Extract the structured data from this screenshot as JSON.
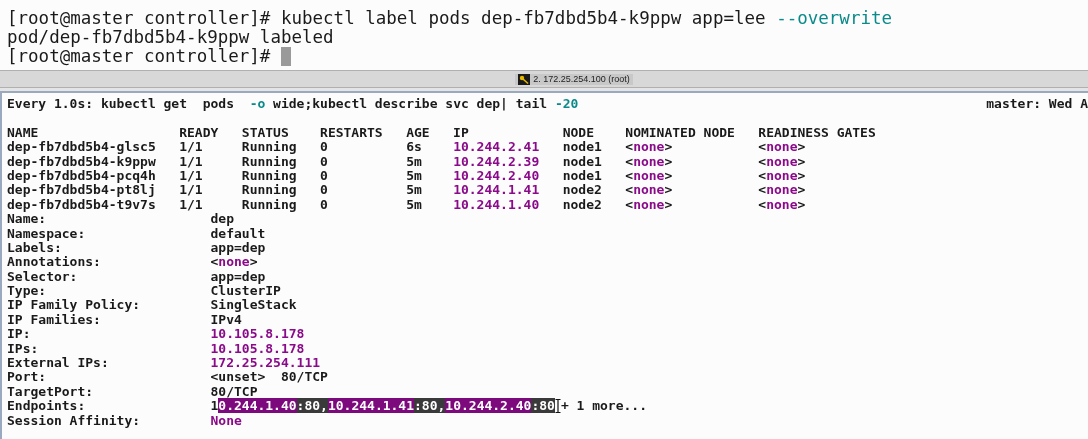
{
  "top_pane": {
    "lines": [
      {
        "segments": [
          {
            "kind": "plain",
            "text": "[root@master controller]# kubectl label pods dep-fb7dbd5b4-k9ppw app=lee "
          },
          {
            "kind": "option",
            "text": "--overwrite"
          }
        ]
      },
      {
        "segments": [
          {
            "kind": "plain",
            "text": "pod/dep-fb7dbd5b4-k9ppw labeled"
          }
        ]
      },
      {
        "segments": [
          {
            "kind": "plain",
            "text": "[root@master controller]# "
          },
          {
            "kind": "cursor"
          }
        ]
      }
    ]
  },
  "tab_bar": {
    "label": "2. 172.25.254.100 (root)"
  },
  "bottom_pane": {
    "header": {
      "segments": [
        {
          "kind": "plain",
          "text": "Every 1.0s: kubectl get  pods  "
        },
        {
          "kind": "option",
          "text": "-o"
        },
        {
          "kind": "plain",
          "text": " wide;kubectl describe svc dep| tail "
        },
        {
          "kind": "option",
          "text": "-20"
        }
      ],
      "right": "master: Wed A"
    },
    "lines": [
      {
        "segments": [
          {
            "kind": "plain",
            "text": "NAME                  READY   STATUS    RESTARTS   AGE   IP            NODE    NOMINATED NODE   READINESS GATES"
          }
        ]
      },
      {
        "segments": [
          {
            "kind": "plain",
            "text": "dep-fb7dbd5b4-glsc5   1/1     Running   0          6s    "
          },
          {
            "kind": "value",
            "text": "10.244.2.41"
          },
          {
            "kind": "plain",
            "text": "   node1   <"
          },
          {
            "kind": "value",
            "text": "none"
          },
          {
            "kind": "plain",
            "text": ">           <"
          },
          {
            "kind": "value",
            "text": "none"
          },
          {
            "kind": "plain",
            "text": ">"
          }
        ]
      },
      {
        "segments": [
          {
            "kind": "plain",
            "text": "dep-fb7dbd5b4-k9ppw   1/1     Running   0          5m    "
          },
          {
            "kind": "value",
            "text": "10.244.2.39"
          },
          {
            "kind": "plain",
            "text": "   node1   <"
          },
          {
            "kind": "value",
            "text": "none"
          },
          {
            "kind": "plain",
            "text": ">           <"
          },
          {
            "kind": "value",
            "text": "none"
          },
          {
            "kind": "plain",
            "text": ">"
          }
        ]
      },
      {
        "segments": [
          {
            "kind": "plain",
            "text": "dep-fb7dbd5b4-pcq4h   1/1     Running   0          5m    "
          },
          {
            "kind": "value",
            "text": "10.244.2.40"
          },
          {
            "kind": "plain",
            "text": "   node1   <"
          },
          {
            "kind": "value",
            "text": "none"
          },
          {
            "kind": "plain",
            "text": ">           <"
          },
          {
            "kind": "value",
            "text": "none"
          },
          {
            "kind": "plain",
            "text": ">"
          }
        ]
      },
      {
        "segments": [
          {
            "kind": "plain",
            "text": "dep-fb7dbd5b4-pt8lj   1/1     Running   0          5m    "
          },
          {
            "kind": "value",
            "text": "10.244.1.41"
          },
          {
            "kind": "plain",
            "text": "   node2   <"
          },
          {
            "kind": "value",
            "text": "none"
          },
          {
            "kind": "plain",
            "text": ">           <"
          },
          {
            "kind": "value",
            "text": "none"
          },
          {
            "kind": "plain",
            "text": ">"
          }
        ]
      },
      {
        "segments": [
          {
            "kind": "plain",
            "text": "dep-fb7dbd5b4-t9v7s   1/1     Running   0          5m    "
          },
          {
            "kind": "value",
            "text": "10.244.1.40"
          },
          {
            "kind": "plain",
            "text": "   node2   <"
          },
          {
            "kind": "value",
            "text": "none"
          },
          {
            "kind": "plain",
            "text": ">           <"
          },
          {
            "kind": "value",
            "text": "none"
          },
          {
            "kind": "plain",
            "text": ">"
          }
        ]
      },
      {
        "segments": [
          {
            "kind": "plain",
            "text": "Name:                     dep"
          }
        ]
      },
      {
        "segments": [
          {
            "kind": "plain",
            "text": "Namespace:                default"
          }
        ]
      },
      {
        "segments": [
          {
            "kind": "plain",
            "text": "Labels:                   app=dep"
          }
        ]
      },
      {
        "segments": [
          {
            "kind": "plain",
            "text": "Annotations:              <"
          },
          {
            "kind": "value",
            "text": "none"
          },
          {
            "kind": "plain",
            "text": ">"
          }
        ]
      },
      {
        "segments": [
          {
            "kind": "plain",
            "text": "Selector:                 app=dep"
          }
        ]
      },
      {
        "segments": [
          {
            "kind": "plain",
            "text": "Type:                     ClusterIP"
          }
        ]
      },
      {
        "segments": [
          {
            "kind": "plain",
            "text": "IP Family Policy:         SingleStack"
          }
        ]
      },
      {
        "segments": [
          {
            "kind": "plain",
            "text": "IP Families:              IPv4"
          }
        ]
      },
      {
        "segments": [
          {
            "kind": "plain",
            "text": "IP:                       "
          },
          {
            "kind": "value",
            "text": "10.105.8.178"
          }
        ]
      },
      {
        "segments": [
          {
            "kind": "plain",
            "text": "IPs:                      "
          },
          {
            "kind": "value",
            "text": "10.105.8.178"
          }
        ]
      },
      {
        "segments": [
          {
            "kind": "plain",
            "text": "External IPs:             "
          },
          {
            "kind": "value",
            "text": "172.25.254.111"
          }
        ]
      },
      {
        "segments": [
          {
            "kind": "plain",
            "text": "Port:                     <unset>  80/TCP"
          }
        ]
      },
      {
        "segments": [
          {
            "kind": "plain",
            "text": "TargetPort:               80/TCP"
          }
        ]
      },
      {
        "segments": [
          {
            "kind": "plain",
            "text": "Endpoints:                1"
          },
          {
            "kind": "selection",
            "parts": [
              {
                "kind": "value",
                "text": "0.244.1.40"
              },
              {
                "kind": "plain",
                "text": ":80,"
              },
              {
                "kind": "value",
                "text": "10.244.1.41"
              },
              {
                "kind": "plain",
                "text": ":80,"
              },
              {
                "kind": "value",
                "text": "10.244.2.40"
              },
              {
                "kind": "plain",
                "text": ":80"
              }
            ]
          },
          {
            "kind": "pointer"
          },
          {
            "kind": "plain",
            "text": "+ 1 more..."
          }
        ]
      },
      {
        "segments": [
          {
            "kind": "plain",
            "text": "Session Affinity:         "
          },
          {
            "kind": "value",
            "text": "None"
          }
        ]
      }
    ]
  }
}
